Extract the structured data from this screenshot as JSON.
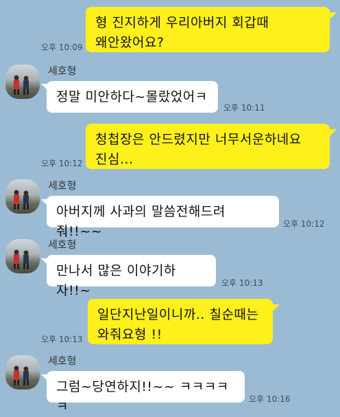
{
  "messages": [
    {
      "type": "out",
      "text": "형 진지하게 우리아버지 회갑때\n왜안왔어요?",
      "time": "오후 10:09"
    },
    {
      "type": "in",
      "sender": "세호형",
      "text": "정말 미안하다~몰랐었어ㅋ",
      "time": "오후 10:11"
    },
    {
      "type": "out",
      "text": "청첩장은 안드렸지만 너무서운하네요\n진심...",
      "time": "오후 10:12"
    },
    {
      "type": "in",
      "sender": "세호형",
      "text": "아버지께 사과의 말씀전해드려줘!!~~",
      "time": "오후 10:12"
    },
    {
      "type": "in",
      "sender": "세호형",
      "text": "만나서 많은 이야기하자!!~",
      "time": "오후 10:13"
    },
    {
      "type": "out",
      "text": "일단지난일이니까.. 칠순때는\n와줘요형 !!",
      "time": "오후 10:13"
    },
    {
      "type": "in",
      "sender": "세호형",
      "text": "그럼~당연하지!!~~ ㅋㅋㅋㅋㅋ",
      "time": "오후 10:16"
    }
  ]
}
